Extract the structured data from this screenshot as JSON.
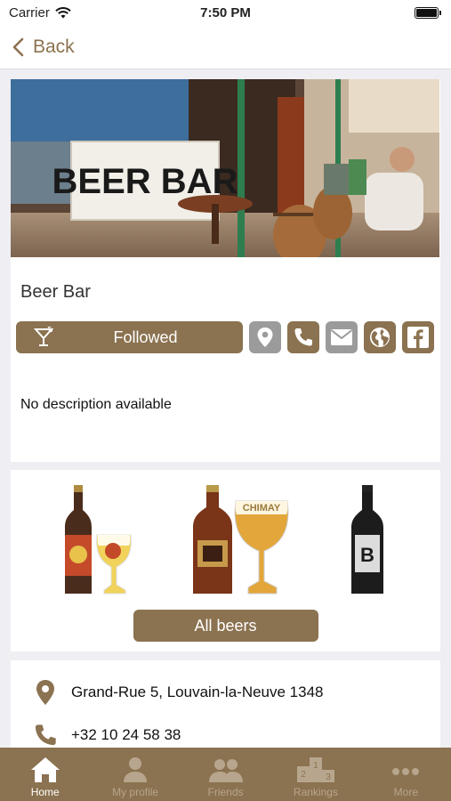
{
  "status_bar": {
    "carrier": "Carrier",
    "time": "7:50 PM"
  },
  "nav": {
    "back_label": "Back"
  },
  "venue": {
    "hero_sign": "BEER BAR",
    "name": "Beer Bar",
    "follow_label": "Followed",
    "description": "No description available"
  },
  "beers": {
    "all_beers_label": "All beers"
  },
  "info": {
    "address": "Grand-Rue 5, Louvain-la-Neuve 1348",
    "phone": "+32 10 24 58 38"
  },
  "tabs": [
    {
      "label": "Home",
      "icon": "home-icon",
      "active": true
    },
    {
      "label": "My profile",
      "icon": "person-icon",
      "active": false
    },
    {
      "label": "Friends",
      "icon": "people-icon",
      "active": false
    },
    {
      "label": "Rankings",
      "icon": "podium-icon",
      "active": false
    },
    {
      "label": "More",
      "icon": "more-icon",
      "active": false
    }
  ],
  "colors": {
    "accent": "#8b7250",
    "disabled": "#9b9b9b",
    "tab_inactive": "#b7a68d"
  }
}
